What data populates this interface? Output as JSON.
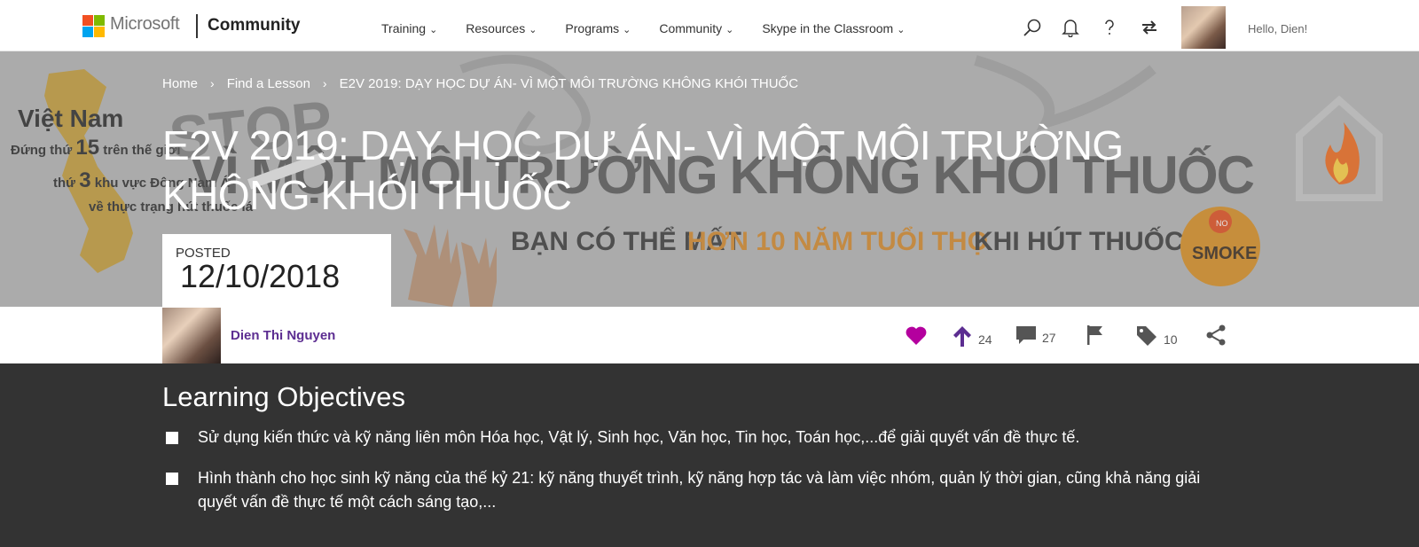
{
  "brand": {
    "company": "Microsoft",
    "site": "Community",
    "logo_colors": [
      "#f25022",
      "#7fba00",
      "#00a4ef",
      "#ffb900"
    ]
  },
  "nav": [
    {
      "label": "Training"
    },
    {
      "label": "Resources"
    },
    {
      "label": "Programs"
    },
    {
      "label": "Community"
    },
    {
      "label": "Skype in the Classroom"
    }
  ],
  "user": {
    "greeting": "Hello, Dien!"
  },
  "breadcrumb": {
    "home": "Home",
    "find": "Find a Lesson",
    "current": "E2V 2019: DẠY HỌC DỰ ÁN- VÌ MỘT MÔI TRƯỜNG KHÔNG KHÓI THUỐC"
  },
  "lesson": {
    "title": "E2V 2019: DẠY HỌC DỰ ÁN- VÌ MỘT MÔI TRƯỜNG KHÔNG KHÓI THUỐC",
    "posted_label": "POSTED",
    "posted_date": "12/10/2018",
    "author": "Dien Thi Nguyen"
  },
  "hero_image": {
    "country": "Việt Nam",
    "line1_prefix": "Đứng thứ",
    "line1_num": "15",
    "line1_suffix": "trên thế giới",
    "line2_prefix": "thứ",
    "line2_num": "3",
    "line2_suffix": "khu vực Đông Nam Á",
    "line3": "về thực trạng hút thuốc lá",
    "stop": "STOP",
    "banner": "VÌ MỘT MÔI TRƯỜNG KHÔNG KHÓI THUỐC",
    "sub_a": "BẠN CÓ THỂ MẤT",
    "sub_b": "HƠN 10 NĂM TUỔI THỌ",
    "sub_c": "KHI HÚT THUỐC LÁ",
    "no": "NO",
    "smoke": "SMOKE"
  },
  "actions": {
    "like_color": "#b4009e",
    "upvotes": "24",
    "comments": "27",
    "tags": "10",
    "accent": "#5c2d91"
  },
  "objectives": {
    "heading": "Learning Objectives",
    "items": [
      "Sử dụng kiến thức và kỹ năng liên môn Hóa học, Vật lý, Sinh học, Văn học, Tin học, Toán học,...để giải quyết vấn đề thực tế.",
      "Hình thành cho học sinh kỹ năng của thế kỷ 21: kỹ năng thuyết trình, kỹ năng hợp tác và làm việc nhóm, quản lý thời gian, cũng khả năng giải quyết vấn đề thực tế một cách sáng tạo,..."
    ]
  }
}
